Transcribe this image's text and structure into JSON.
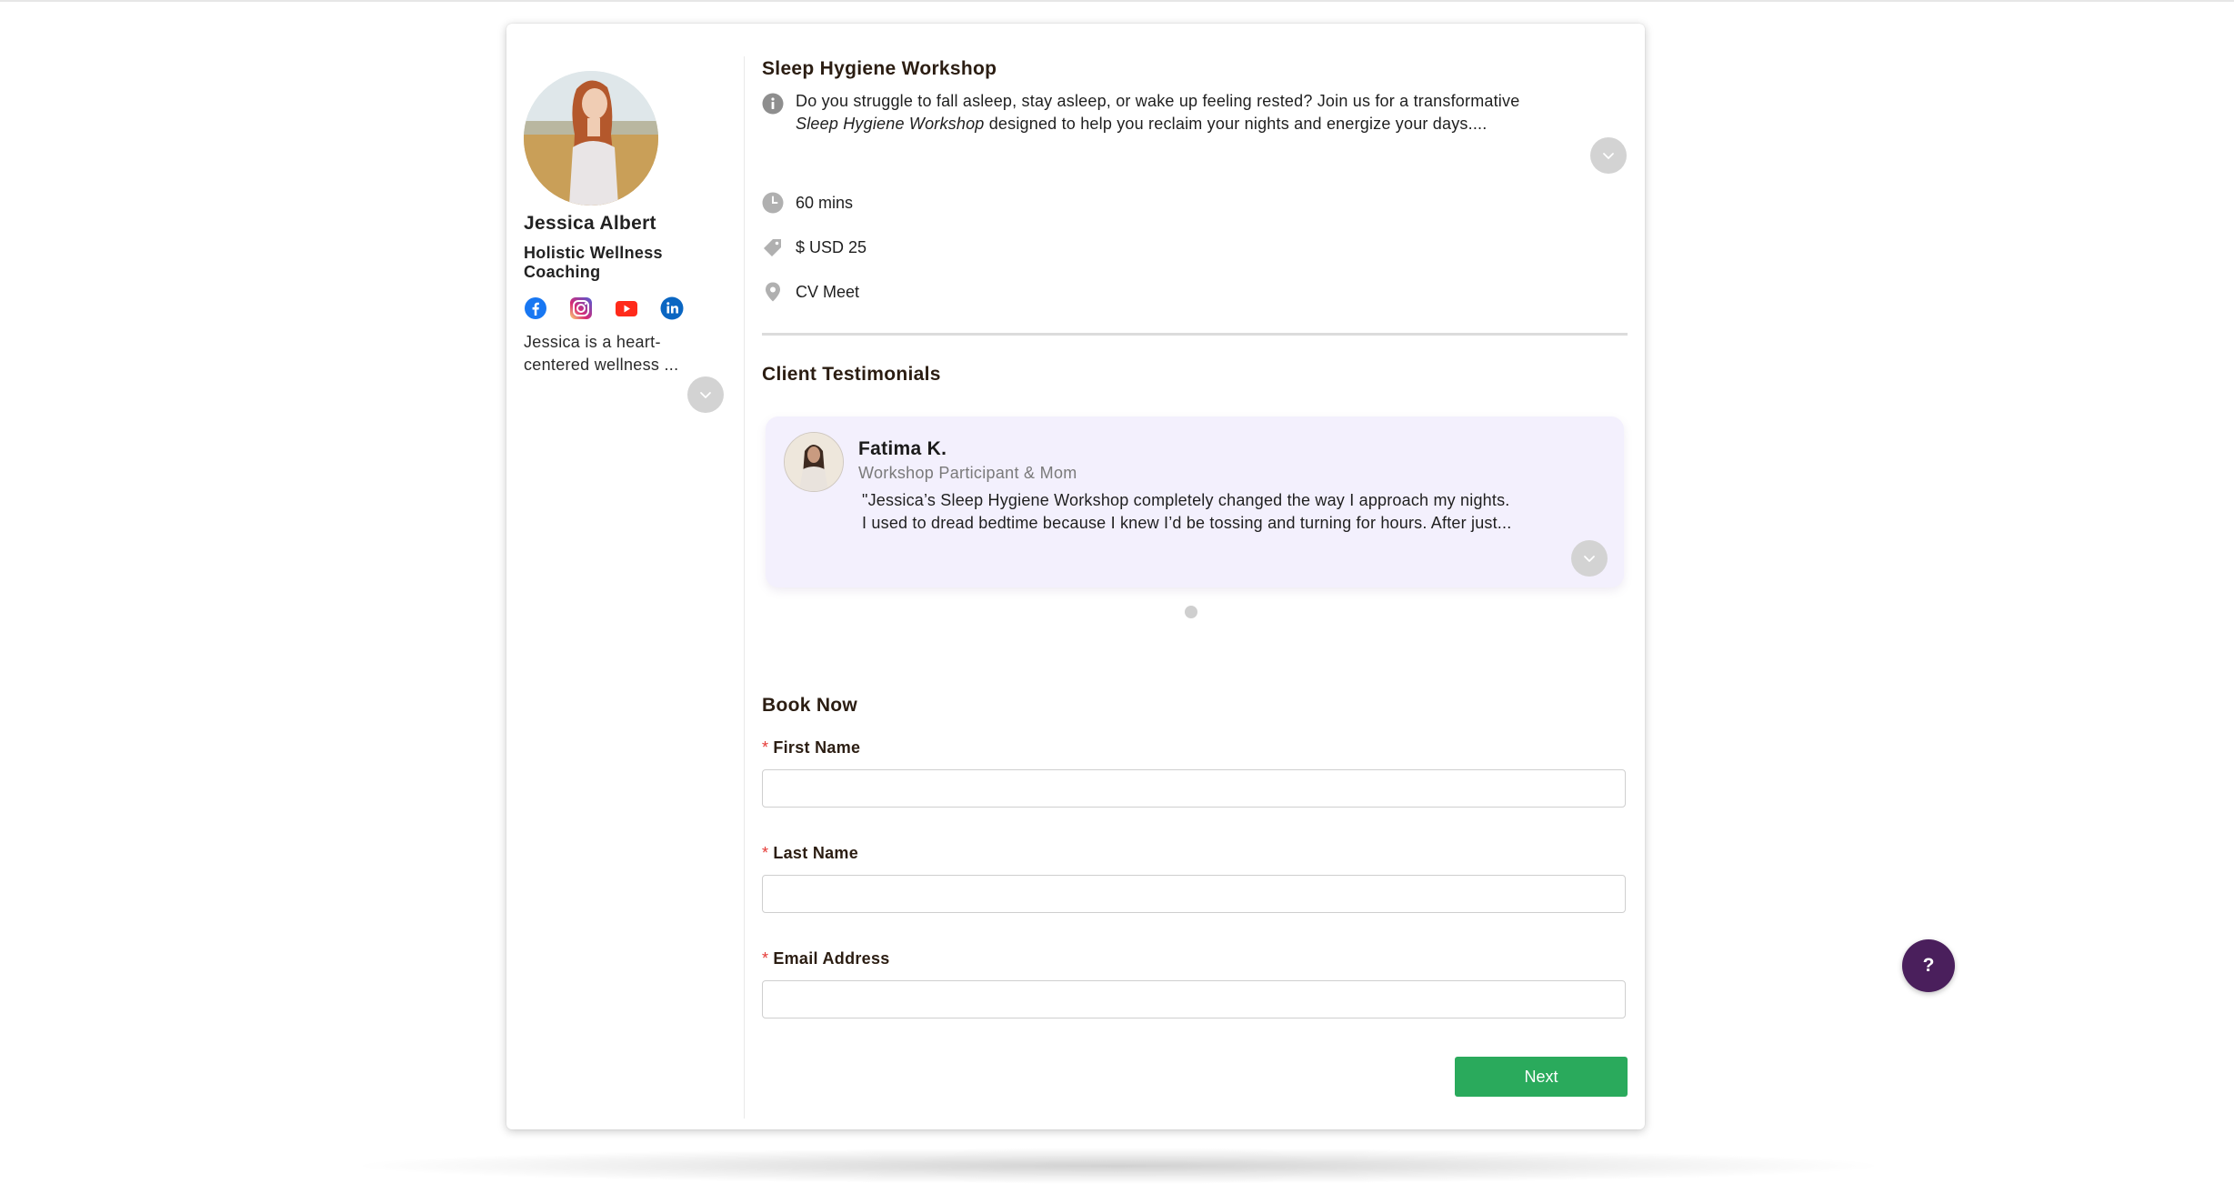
{
  "coach": {
    "name": "Jessica Albert",
    "title": "Holistic Wellness Coaching",
    "bio_line1": "Jessica is a heart-",
    "bio_line2": "centered wellness ...",
    "socials": [
      "facebook-icon",
      "instagram-icon",
      "youtube-icon",
      "linkedin-icon"
    ]
  },
  "event": {
    "title": "Sleep Hygiene Workshop",
    "desc_line1": "Do you struggle to fall asleep, stay asleep, or wake up feeling rested? Join us for a transformative",
    "desc_italic": "Sleep Hygiene Workshop",
    "desc_line2_rest": " designed to help you reclaim your nights and energize your days....",
    "duration": "60 mins",
    "price": "$ USD 25",
    "location": "CV Meet"
  },
  "testimonials": {
    "heading": "Client Testimonials",
    "items": [
      {
        "name": "Fatima K.",
        "role": "Workshop Participant & Mom",
        "quote_line1": "\"Jessica’s Sleep Hygiene Workshop completely changed the way I approach my nights.",
        "quote_line2": "I used to dread bedtime because I knew I’d be tossing and turning for hours. After just..."
      }
    ]
  },
  "booking": {
    "heading": "Book Now",
    "required_mark": "*",
    "first_name_label": "First Name",
    "last_name_label": "Last Name",
    "email_label": "Email Address",
    "next_label": "Next"
  },
  "help": {
    "label": "?"
  },
  "colors": {
    "accent_green": "#2aaa5c",
    "help_purple": "#4a1f5c",
    "testimonial_bg": "#f3f0fd",
    "required_red": "#e53935"
  }
}
